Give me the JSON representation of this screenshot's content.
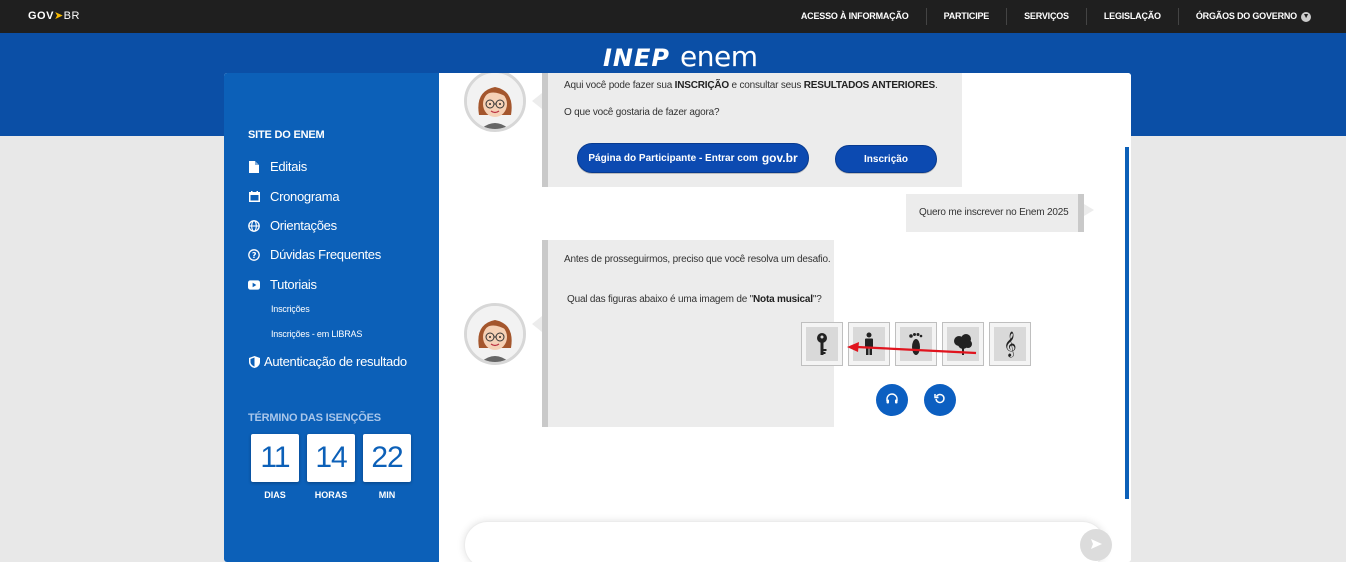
{
  "govbar": {
    "logo_gov": "GOV",
    "logo_br": "BR",
    "nav": [
      "ACESSO À INFORMAÇÃO",
      "PARTICIPE",
      "SERVIÇOS",
      "LEGISLAÇÃO",
      "ÓRGÃOS DO GOVERNO"
    ]
  },
  "header": {
    "inep": "INEP",
    "enem": "enem"
  },
  "sidebar": {
    "title": "SITE DO ENEM",
    "items": [
      {
        "label": "Editais",
        "icon": "document-icon"
      },
      {
        "label": "Cronograma",
        "icon": "calendar-icon"
      },
      {
        "label": "Orientações",
        "icon": "globe-icon"
      },
      {
        "label": "Dúvidas Frequentes",
        "icon": "question-icon"
      },
      {
        "label": "Tutoriais",
        "icon": "youtube-icon"
      }
    ],
    "subitems": [
      "Inscrições",
      "Inscrições - em LIBRAS"
    ],
    "auth": {
      "label": "Autenticação de resultado",
      "icon": "shield-icon"
    },
    "countdown": {
      "title": "TÉRMINO DAS ISENÇÕES",
      "days": "11",
      "hours": "14",
      "mins": "22",
      "days_label": "DIAS",
      "hours_label": "HORAS",
      "mins_label": "MIN"
    }
  },
  "chat": {
    "msg1": {
      "line1_pre": "Aqui você pode fazer sua ",
      "line1_b1": "INSCRIÇÃO",
      "line1_mid": " e consultar seus ",
      "line1_b2": "RESULTADOS ANTERIORES",
      "line1_post": ".",
      "line2": "O que você gostaria de fazer agora?",
      "btn_participant": "Página do Participante - Entrar com",
      "btn_participant_brand": "gov.br",
      "btn_inscricao": "Inscrição"
    },
    "user_msg": "Quero me inscrever no Enem 2025",
    "msg2": {
      "line1": "Antes de prosseguirmos, preciso que você resolva um desafio.",
      "q_pre": "Qual das figuras abaixo é uma imagem de \"",
      "q_b": "Nota musical",
      "q_post": "\"?",
      "options": [
        "key-icon",
        "person-icon",
        "footprint-icon",
        "tree-icon",
        "music-note-icon"
      ]
    }
  },
  "colors": {
    "primary": "#0c60b8",
    "header": "#0b4fa6",
    "govbar": "#1f1f1f",
    "arrow": "#e0141e"
  }
}
